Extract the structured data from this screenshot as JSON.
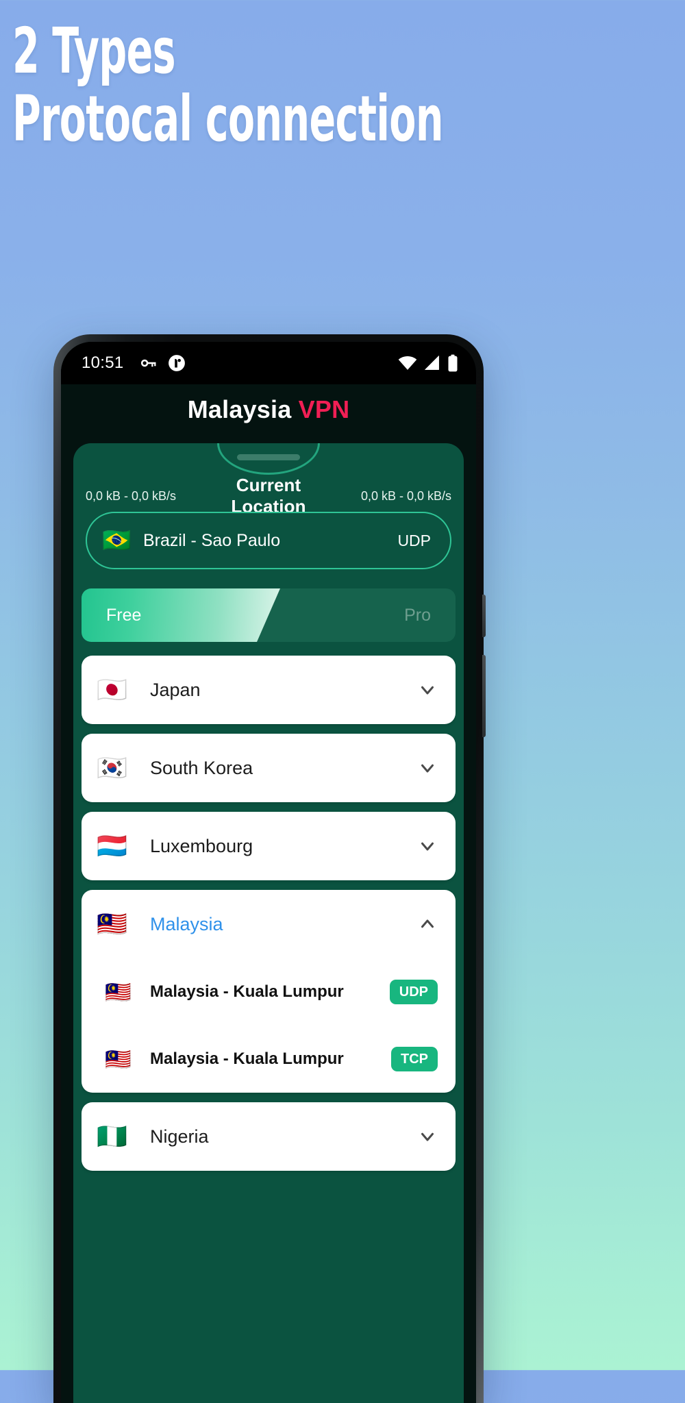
{
  "promo": {
    "line1": "2 Types",
    "line2": "Protocal connection"
  },
  "statusbar": {
    "time": "10:51",
    "icons": [
      "vpn-key-icon",
      "app-notification-icon",
      "wifi-icon",
      "signal-icon",
      "battery-icon"
    ]
  },
  "header": {
    "title_main": "Malaysia",
    "title_accent": "VPN"
  },
  "panel": {
    "speed_left": "0,0 kB - 0,0 kB/s",
    "speed_right": "0,0 kB - 0,0 kB/s",
    "title": "Current Location",
    "current": {
      "flag": "🇧🇷",
      "name": "Brazil - Sao Paulo",
      "protocol": "UDP"
    }
  },
  "tabs": {
    "free": "Free",
    "pro": "Pro",
    "active": "Free"
  },
  "countries": [
    {
      "flag": "🇯🇵",
      "name": "Japan",
      "expanded": false,
      "servers": []
    },
    {
      "flag": "🇰🇷",
      "name": "South Korea",
      "expanded": false,
      "servers": []
    },
    {
      "flag": "🇱🇺",
      "name": "Luxembourg",
      "expanded": false,
      "servers": []
    },
    {
      "flag": "🇲🇾",
      "name": "Malaysia",
      "expanded": true,
      "servers": [
        {
          "flag": "🇲🇾",
          "name": "Malaysia - Kuala Lumpur",
          "protocol": "UDP"
        },
        {
          "flag": "🇲🇾",
          "name": "Malaysia - Kuala Lumpur",
          "protocol": "TCP"
        }
      ]
    },
    {
      "flag": "🇳🇬",
      "name": "Nigeria",
      "expanded": false,
      "servers": []
    }
  ],
  "colors": {
    "background_top": "#87acea",
    "background_bottom": "#abf2d3",
    "sheet_green": "#0b5340",
    "accent_pink": "#f01f55",
    "accent_teal": "#23c48f",
    "badge_green": "#18b67f",
    "link_blue": "#2f91ea"
  }
}
